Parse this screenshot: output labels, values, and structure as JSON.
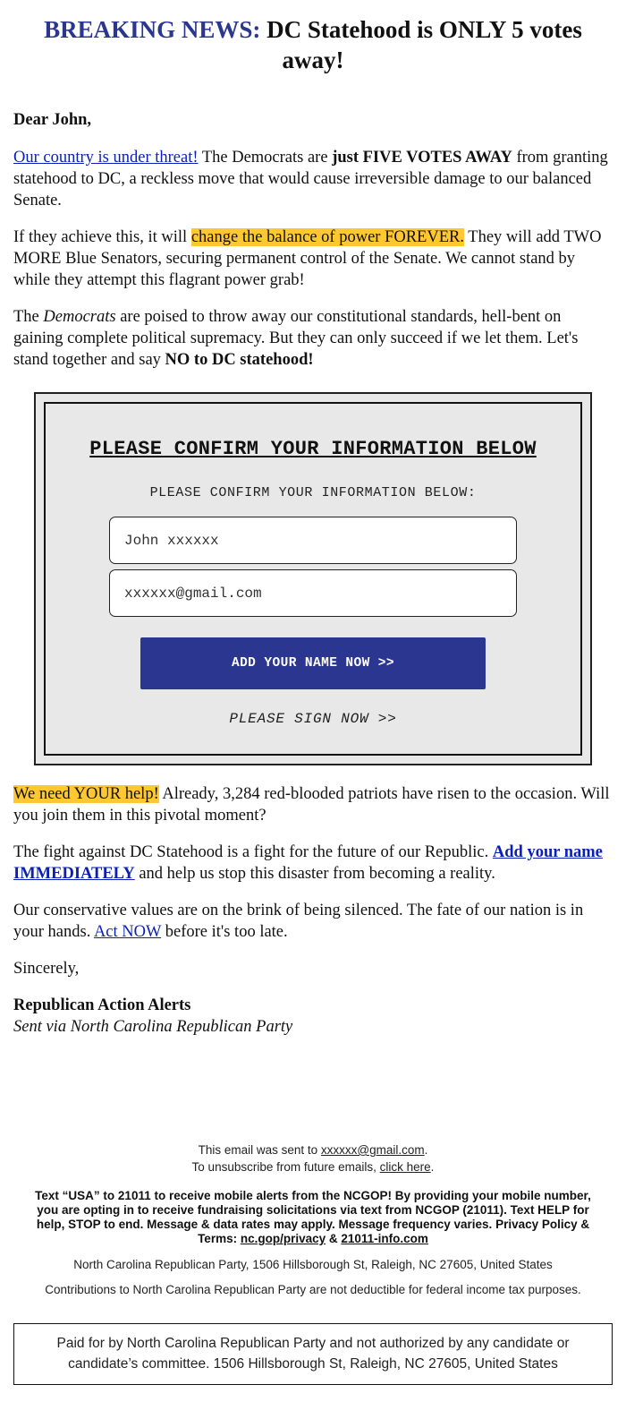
{
  "headline": {
    "accent": "BREAKING NEWS:",
    "rest": " DC Statehood is ONLY 5 votes away!",
    "accent_color": "#2b3690"
  },
  "greeting": "Dear John,",
  "paragraphs": {
    "p1": {
      "link": "Our country is under threat!",
      "text1": " The Democrats are ",
      "bold": "just FIVE VOTES AWAY",
      "text2": " from granting statehood to DC, a reckless move that would cause irreversible damage to our balanced Senate."
    },
    "p2": {
      "text1": "If they achieve this, it will ",
      "highlight": "change the balance of power FOREVER.",
      "text2": " They will add TWO MORE Blue Senators, securing permanent control of the Senate. We cannot stand by while they attempt this flagrant power grab!"
    },
    "p3": {
      "text1": "The ",
      "italic": "Democrats",
      "text2": " are poised to throw away our constitutional standards, hell-bent on gaining complete political supremacy. But they can only succeed if we let them. Let's stand together and say ",
      "bold": "NO to DC statehood!"
    },
    "p4": {
      "highlight": "We need YOUR help!",
      "text1": " Already, 3,284 red-blooded patriots have risen to the occasion. Will you join them in this pivotal moment?"
    },
    "p5": {
      "text1": "The fight against DC Statehood is a fight for the future of our Republic. ",
      "link": "Add your name IMMEDIATELY",
      "text2": " and help us stop this disaster from becoming a reality."
    },
    "p6": {
      "text1": "Our conservative values are on the brink of being silenced. The fate of our nation is in your hands. ",
      "link": "Act NOW",
      "text2": " before it's too late."
    }
  },
  "highlight_color": "#ffc833",
  "form": {
    "title": "PLEASE CONFIRM YOUR INFORMATION BELOW",
    "subtitle": "PLEASE CONFIRM YOUR INFORMATION BELOW:",
    "name_value": "John xxxxxx",
    "email_value": "xxxxxx@gmail.com",
    "cta_label": "ADD YOUR NAME NOW >>",
    "cta_color": "#2b3690",
    "sign_now": "PLEASE SIGN NOW >>"
  },
  "signoff": {
    "closing": "Sincerely,",
    "name": "Republican Action Alerts",
    "via": "Sent via North Carolina Republican Party"
  },
  "footer": {
    "sent_to_prefix": "This email was sent to ",
    "sent_to_email": "xxxxxx@gmail.com",
    "sent_to_suffix": ".",
    "unsub_prefix": "To unsubscribe from future emails, ",
    "unsub_link": "click here",
    "unsub_suffix": ".",
    "sms_text": "Text “USA” to 21011 to receive mobile alerts from the NCGOP! By providing your mobile number, you are opting in to receive fundraising solicitations via text from NCGOP (21011). Text HELP for help, STOP to end. Message & data rates may apply. Message frequency varies. Privacy Policy & Terms: ",
    "privacy_link": "nc.gop/privacy",
    "amp": " & ",
    "info_link": "21011-info.com",
    "address": "North Carolina Republican Party, 1506 Hillsborough St, Raleigh, NC 27605, United States",
    "contributions": "Contributions to North Carolina Republican Party are not deductible for federal income tax purposes.",
    "paid_for": "Paid for by North Carolina Republican Party and not authorized by any candidate or candidate’s committee. 1506 Hillsborough St, Raleigh, NC 27605, United States"
  }
}
